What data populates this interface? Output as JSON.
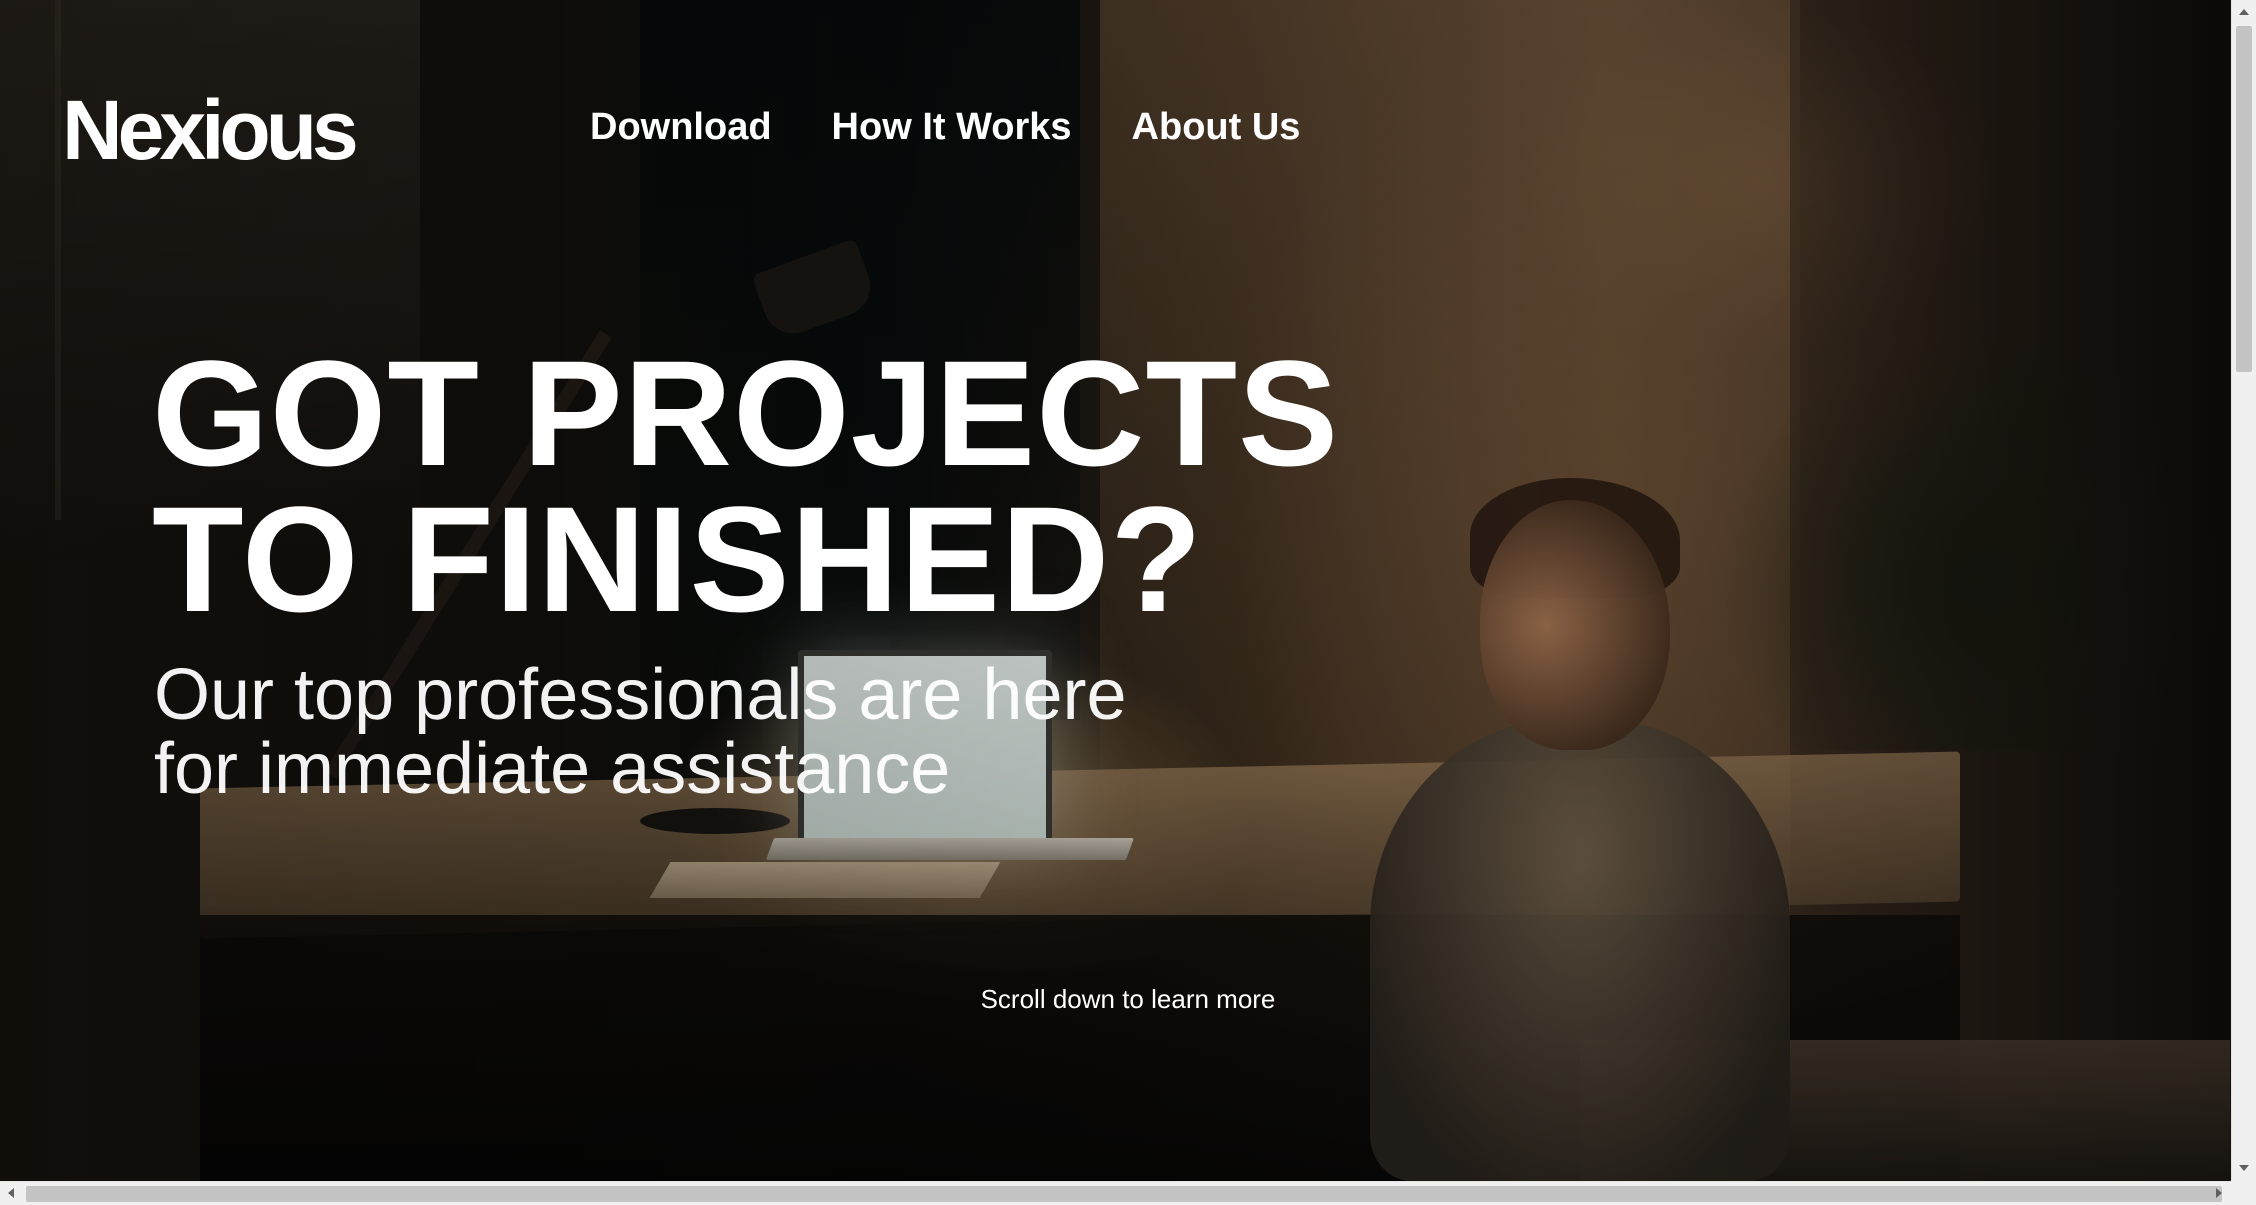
{
  "header": {
    "logo": "Nexious",
    "nav": [
      {
        "label": "Download"
      },
      {
        "label": "How It Works"
      },
      {
        "label": "About Us"
      }
    ]
  },
  "hero": {
    "title_lines": [
      "GOT PROJECTS",
      "TO FINISHED?"
    ],
    "subtitle_lines": [
      "Our top professionals are here",
      "for immediate assistance"
    ],
    "scroll_hint": "Scroll down to learn more"
  },
  "background": {
    "image": "person-at-desk-with-lamp-and-laptop"
  },
  "scrollbars": {
    "vertical": {
      "icon_up": "chevron-up-icon",
      "icon_down": "chevron-down-icon"
    },
    "horizontal": {
      "icon_left": "chevron-left-icon",
      "icon_right": "chevron-right-icon"
    }
  },
  "colors": {
    "text": "#ffffff",
    "scrollbar_track": "#f0f0f0",
    "scrollbar_thumb": "#c4c4c4"
  }
}
